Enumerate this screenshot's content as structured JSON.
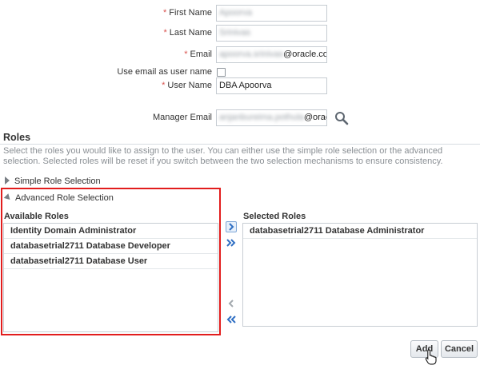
{
  "form": {
    "first_name": {
      "label": "First Name",
      "required_mark": "*",
      "value": "Apoorva"
    },
    "last_name": {
      "label": "Last Name",
      "required_mark": "*",
      "value": "Srinivas"
    },
    "email": {
      "label": "Email",
      "required_mark": "*",
      "value_hidden": "apoorva.srinivas",
      "value_visible": "@oracle.com"
    },
    "use_email": {
      "label": "Use email as user name",
      "checked": false
    },
    "user_name": {
      "label": "User Name",
      "required_mark": "*",
      "value": "DBA Apoorva"
    },
    "manager_email": {
      "label": "Manager Email",
      "value_hidden": "anjanbureima.pothula",
      "value_visible": "@oracle."
    }
  },
  "roles": {
    "title": "Roles",
    "description": "Select the roles you would like to assign to the user. You can either use the simple role selection or the advanced selection. Selected roles will be reset if you switch between the two selection mechanisms to ensure consistency.",
    "simple_label": "Simple Role Selection",
    "advanced_label": "Advanced Role Selection",
    "available_title": "Available Roles",
    "available": [
      "Identity Domain Administrator",
      "databasetrial2711 Database Developer",
      "databasetrial2711 Database User"
    ],
    "selected_title": "Selected Roles",
    "selected": [
      "databasetrial2711 Database Administrator"
    ]
  },
  "buttons": {
    "add": "Add",
    "cancel": "Cancel"
  },
  "colors": {
    "highlight": "#e21d1d",
    "shuttle": "#2f6fc3",
    "required": "#d9534f"
  },
  "icons": [
    "search-icon",
    "move-selected-icon",
    "move-all-icon",
    "remove-selected-icon",
    "remove-all-icon",
    "hand-cursor-icon"
  ]
}
